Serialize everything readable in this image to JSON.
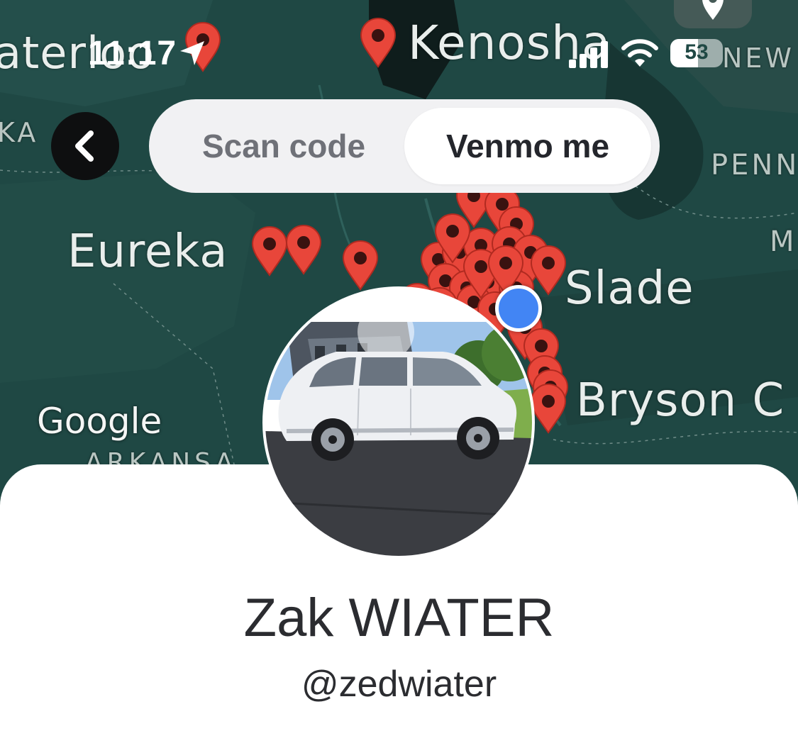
{
  "status_bar": {
    "time": "11:17",
    "battery_level": "53",
    "battery_fraction": 0.53
  },
  "map": {
    "labels": {
      "waterloo": "aterloo",
      "kenosha": "Kenosha",
      "new": "NEW",
      "ka": "KA",
      "penn": "PENN",
      "m": "M",
      "eureka": "Eureka",
      "slade": "Slade",
      "bryson": "Bryson C",
      "arkansas": "ARKANSA"
    },
    "provider_logo": "Google",
    "colors": {
      "water": "#1f4844",
      "pin": "#e8463a",
      "user_location": "#4285f4"
    }
  },
  "header": {
    "back_icon": "chevron-left-icon",
    "tabs": [
      {
        "label": "Scan code",
        "selected": false
      },
      {
        "label": "Venmo me",
        "selected": true
      }
    ]
  },
  "profile": {
    "name": "Zak WIATER",
    "handle": "@zedwiater",
    "avatar_icon": "white-minivan-photo"
  }
}
